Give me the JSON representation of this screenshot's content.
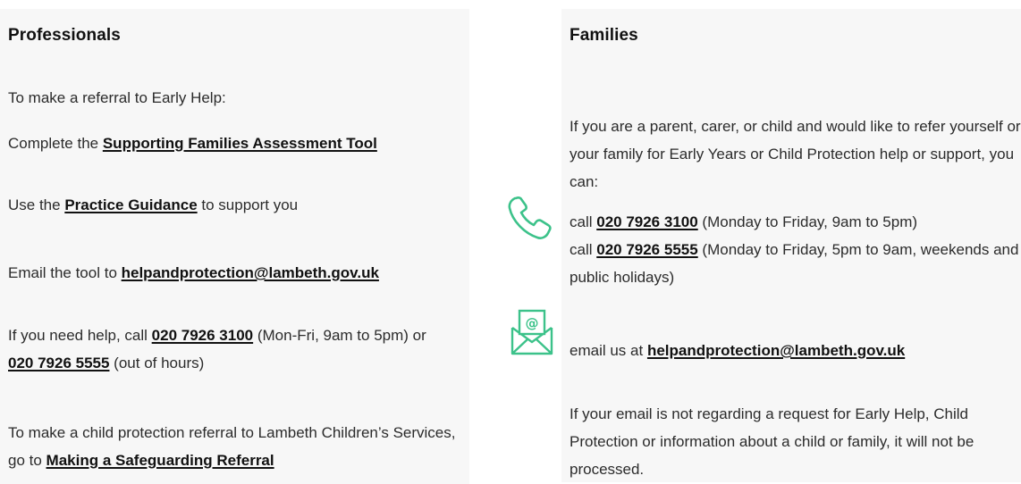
{
  "professionals": {
    "title": "Professionals",
    "intro": "To make a referral to Early Help:",
    "sfat_prefix": "Complete the ",
    "sfat_link": "Supporting Families Assessment Tool",
    "guidance_prefix": "Use the ",
    "guidance_link": "Practice Guidance",
    "guidance_suffix": " to support you",
    "email_prefix": "Email the tool to ",
    "email_link": "helpandprotection@lambeth.gov.uk",
    "help_prefix": "If you need help, call ",
    "help_phone1": "020 7926 3100",
    "help_middle": " (Mon-Fri, 9am to 5pm) or ",
    "help_phone2": "020 7926 5555",
    "help_suffix": " (out of hours)",
    "cp_prefix": "To make a child protection referral to Lambeth Children’s Services, go to ",
    "cp_link": "Making a Safeguarding Referral"
  },
  "families": {
    "title": "Families",
    "intro": "If you are a parent, carer, or child and would like to refer yourself or your family for Early Years or Child Protection help or support, you can:",
    "call1_prefix": "call ",
    "call1_phone": "020 7926 3100",
    "call1_suffix": " (Monday to Friday, 9am to 5pm)",
    "call2_prefix": "call ",
    "call2_phone": "020 7926 5555",
    "call2_suffix": " (Monday to Friday, 5pm to 9am, weekends and public holidays)",
    "email_prefix": "email us at ",
    "email_link": "helpandprotection@lambeth.gov.uk",
    "note": "If your email is not regarding a request for Early Help, Child Protection or information about a child or family, it will not be processed."
  },
  "icons": {
    "phone": "phone-icon",
    "mail": "mail-icon",
    "accent": "#3cc28a"
  }
}
